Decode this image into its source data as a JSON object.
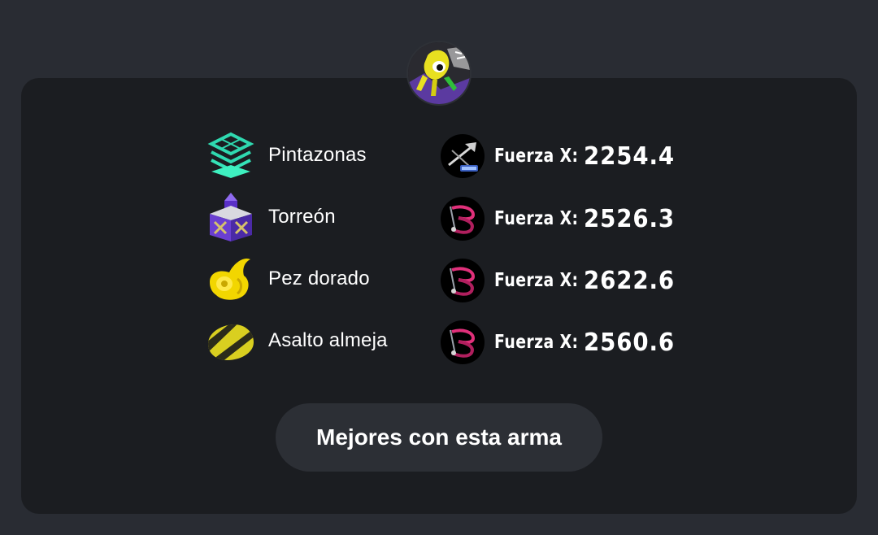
{
  "player": {
    "avatar_icon": "inkling-avatar-icon"
  },
  "modes": [
    {
      "label": "Pintazonas",
      "icon": "splat-zones-icon",
      "weapon_icon": "splatana-icon",
      "power_label": "Fuerza X:",
      "power_value": "2254.4"
    },
    {
      "label": "Torreón",
      "icon": "tower-control-icon",
      "weapon_icon": "tri-stringer-icon",
      "power_label": "Fuerza X:",
      "power_value": "2526.3"
    },
    {
      "label": "Pez dorado",
      "icon": "rainmaker-icon",
      "weapon_icon": "tri-stringer-icon",
      "power_label": "Fuerza X:",
      "power_value": "2622.6"
    },
    {
      "label": "Asalto almeja",
      "icon": "clam-blitz-icon",
      "weapon_icon": "tri-stringer-icon",
      "power_label": "Fuerza X:",
      "power_value": "2560.6"
    }
  ],
  "actions": {
    "best_with_weapon_label": "Mejores con esta arma"
  },
  "colors": {
    "page_bg": "#292c33",
    "card_bg": "#1b1d21",
    "button_bg": "#2c2f35",
    "text": "#ffffff",
    "splat_zones": "#2fd9b0",
    "tower": "#6a3fd1",
    "rainmaker": "#f2d600",
    "clam": "#c9c21a",
    "weapon_accent": "#e0307a"
  }
}
